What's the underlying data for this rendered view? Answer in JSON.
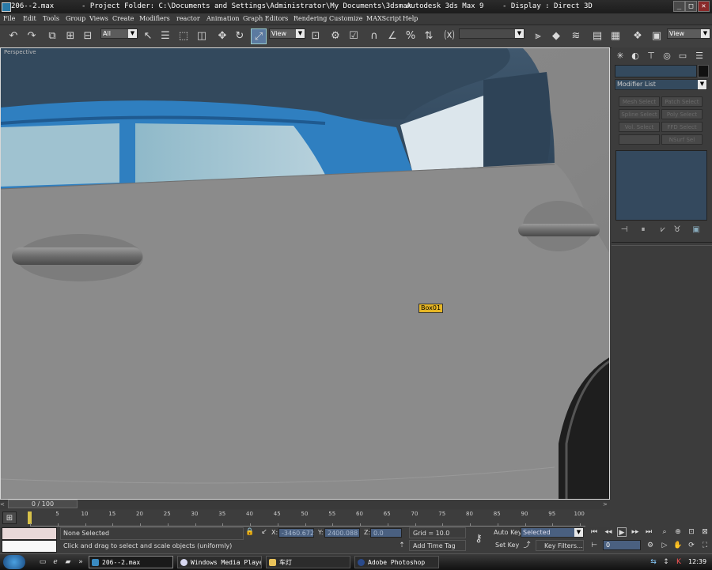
{
  "titlebar": {
    "file": "206--2.max",
    "project": "- Project Folder: C:\\Documents and Settings\\Administrator\\My Documents\\3dsmax",
    "app": "- Autodesk 3ds Max 9",
    "display": "- Display : Direct 3D"
  },
  "menu": [
    "File",
    "Edit",
    "Tools",
    "Group",
    "Views",
    "Create",
    "Modifiers",
    "reactor",
    "Animation",
    "Graph Editors",
    "Rendering",
    "Customize",
    "MAXScript",
    "Help"
  ],
  "toolbar": {
    "selection_filter": "All",
    "ref_coord": "View",
    "named_selection": "",
    "render_view": "View"
  },
  "viewport": {
    "label": "Perspective",
    "object_tag": "Box01"
  },
  "panel": {
    "name_field": "",
    "modifier_list": "Modifier List",
    "buttons": [
      "Mesh Select",
      "Patch Select",
      "Spline Select",
      "Poly Select",
      "Vol. Select",
      "FFD Select",
      "",
      "NSurf Sel"
    ]
  },
  "timeline": {
    "frame_readout": "0 / 100",
    "ticks": [
      "0",
      "5",
      "10",
      "15",
      "20",
      "25",
      "30",
      "35",
      "40",
      "45",
      "50",
      "55",
      "60",
      "65",
      "70",
      "75",
      "80",
      "85",
      "90",
      "95",
      "100"
    ]
  },
  "status": {
    "selection": "None Selected",
    "prompt": "Click and drag to select and scale objects (uniformly)",
    "x_label": "X:",
    "x_value": "-3460.672",
    "y_label": "Y:",
    "y_value": "2400.088",
    "z_label": "Z:",
    "z_value": "0.0",
    "grid": "Grid = 10.0",
    "add_time_tag": "Add Time Tag",
    "auto_key": "Auto Key",
    "auto_key_mode": "Selected",
    "set_key": "Set Key",
    "key_filters": "Key Filters...",
    "current_frame": "0"
  },
  "taskbar": {
    "tasks": [
      "206--2.max",
      "Windows Media Player",
      "车灯",
      "Adobe Photoshop"
    ],
    "clock": "12:39"
  },
  "colors": {
    "accent": "#5b7aa0",
    "viewport_bg": "#8a8a8a",
    "car_blue": "#2f7fc0",
    "selection_tag": "#e6b625"
  }
}
